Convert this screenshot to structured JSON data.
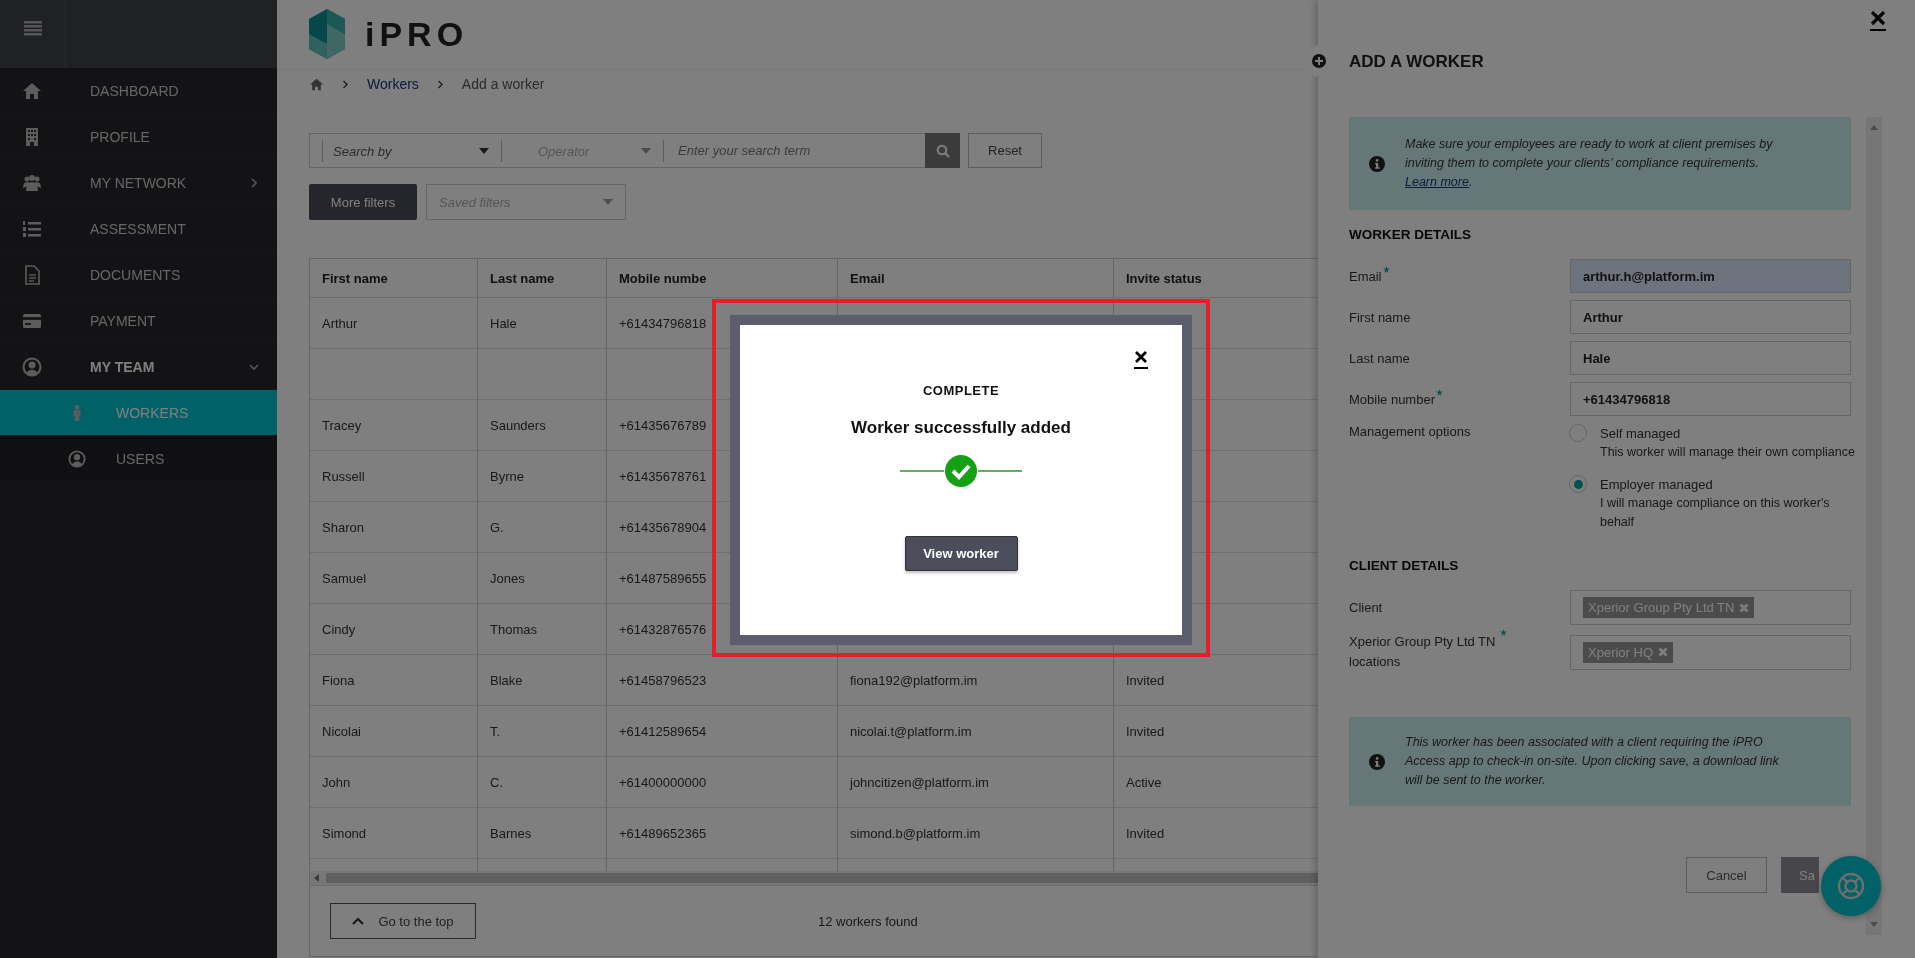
{
  "sidebar": {
    "items": [
      {
        "label": "DASHBOARD",
        "selected": false
      },
      {
        "label": "PROFILE",
        "selected": false
      },
      {
        "label": "MY NETWORK",
        "selected": false,
        "expanded": false
      },
      {
        "label": "ASSESSMENT",
        "selected": false
      },
      {
        "label": "DOCUMENTS",
        "selected": false
      },
      {
        "label": "PAYMENT",
        "selected": false
      },
      {
        "label": "MY TEAM",
        "selected": false,
        "expanded": true,
        "children": [
          {
            "label": "WORKERS",
            "selected": true
          },
          {
            "label": "USERS",
            "selected": false
          }
        ]
      }
    ]
  },
  "header": {
    "logo": "iPRO"
  },
  "breadcrumb": [
    {
      "label": "Workers",
      "kind": "link"
    },
    {
      "label": "Add a worker",
      "kind": "current"
    }
  ],
  "search": {
    "search_by": {
      "placeholder": "Search by",
      "disabled": false
    },
    "operator": {
      "placeholder": "Operator",
      "disabled": true
    },
    "term": {
      "placeholder": "Enter your search term"
    },
    "reset": "Reset",
    "more_filters": "More filters",
    "saved_filters": {
      "placeholder": "Saved filters",
      "disabled": true
    }
  },
  "table": {
    "columns": [
      "First name",
      "Last name",
      "Mobile numbe",
      "Email",
      "Invite status"
    ],
    "rows": [
      {
        "first_name": "Arthur",
        "last_name": "Hale",
        "mobile": "+61434796818"
      },
      {},
      {
        "first_name": "Tracey",
        "last_name": "Saunders",
        "mobile": "+61435676789"
      },
      {
        "first_name": "Russell",
        "last_name": "Byrne",
        "mobile": "+61435678761"
      },
      {
        "first_name": "Sharon",
        "last_name": "G.",
        "mobile": "+61435678904"
      },
      {
        "first_name": "Samuel",
        "last_name": "Jones",
        "mobile": "+61487589655"
      },
      {
        "first_name": "Cindy",
        "last_name": "Thomas",
        "mobile": "+61432876576"
      },
      {
        "first_name": "Fiona",
        "last_name": "Blake",
        "mobile": "+61458796523",
        "email": "fiona192@platform.im",
        "status": "Invited"
      },
      {
        "first_name": "Nicolai",
        "last_name": "T.",
        "mobile": "+61412589654",
        "email": "nicolai.t@platform.im",
        "status": "Invited"
      },
      {
        "first_name": "John",
        "last_name": "C.",
        "mobile": "+61400000000",
        "email": "johncitizen@platform.im",
        "status": "Active"
      },
      {
        "first_name": "Simond",
        "last_name": "Barnes",
        "mobile": "+61489652365",
        "email": "simond.b@platform.im",
        "status": "Invited"
      }
    ],
    "go_top": "Go to the top",
    "count": "12 workers found"
  },
  "panel": {
    "title": "ADD A WORKER",
    "intro": {
      "text": "Make sure your employees are ready to work at client premises by inviting them to complete your clients’ compliance requirements. ",
      "link": "Learn more",
      "after": "."
    },
    "worker_details": {
      "heading": "WORKER DETAILS",
      "fields": [
        {
          "label": "Email",
          "required": true,
          "value": "arthur.h@platform.im",
          "focused": true
        },
        {
          "label": "First name",
          "required": false,
          "value": "Arthur",
          "focused": false
        },
        {
          "label": "Last name",
          "required": false,
          "value": "Hale",
          "focused": false
        },
        {
          "label": "Mobile number",
          "required": true,
          "value": "+61434796818",
          "focused": false
        }
      ]
    },
    "management": {
      "label": "Management options",
      "options": [
        {
          "title": "Self managed",
          "description": "This worker will manage their own compliance",
          "selected": false
        },
        {
          "title": "Employer managed",
          "description": "I will manage compliance on this worker's behalf",
          "selected": true
        }
      ]
    },
    "client_details": {
      "heading": "CLIENT DETAILS",
      "fields": [
        {
          "label": "Client",
          "required": false,
          "tags": [
            "Xperior Group Pty Ltd TN"
          ]
        },
        {
          "label": "Xperior Group Pty Ltd TN locations",
          "required": true,
          "tags": [
            "Xperior HQ"
          ]
        }
      ]
    },
    "notice": "This worker has been associated with a client requiring the iPRO Access app to check-in on-site. Upon clicking save, a download link will be sent to the worker.",
    "cancel": "Cancel",
    "save": "Sa"
  },
  "modal": {
    "status": "COMPLETE",
    "message": "Worker successfully added",
    "button": "View worker"
  }
}
